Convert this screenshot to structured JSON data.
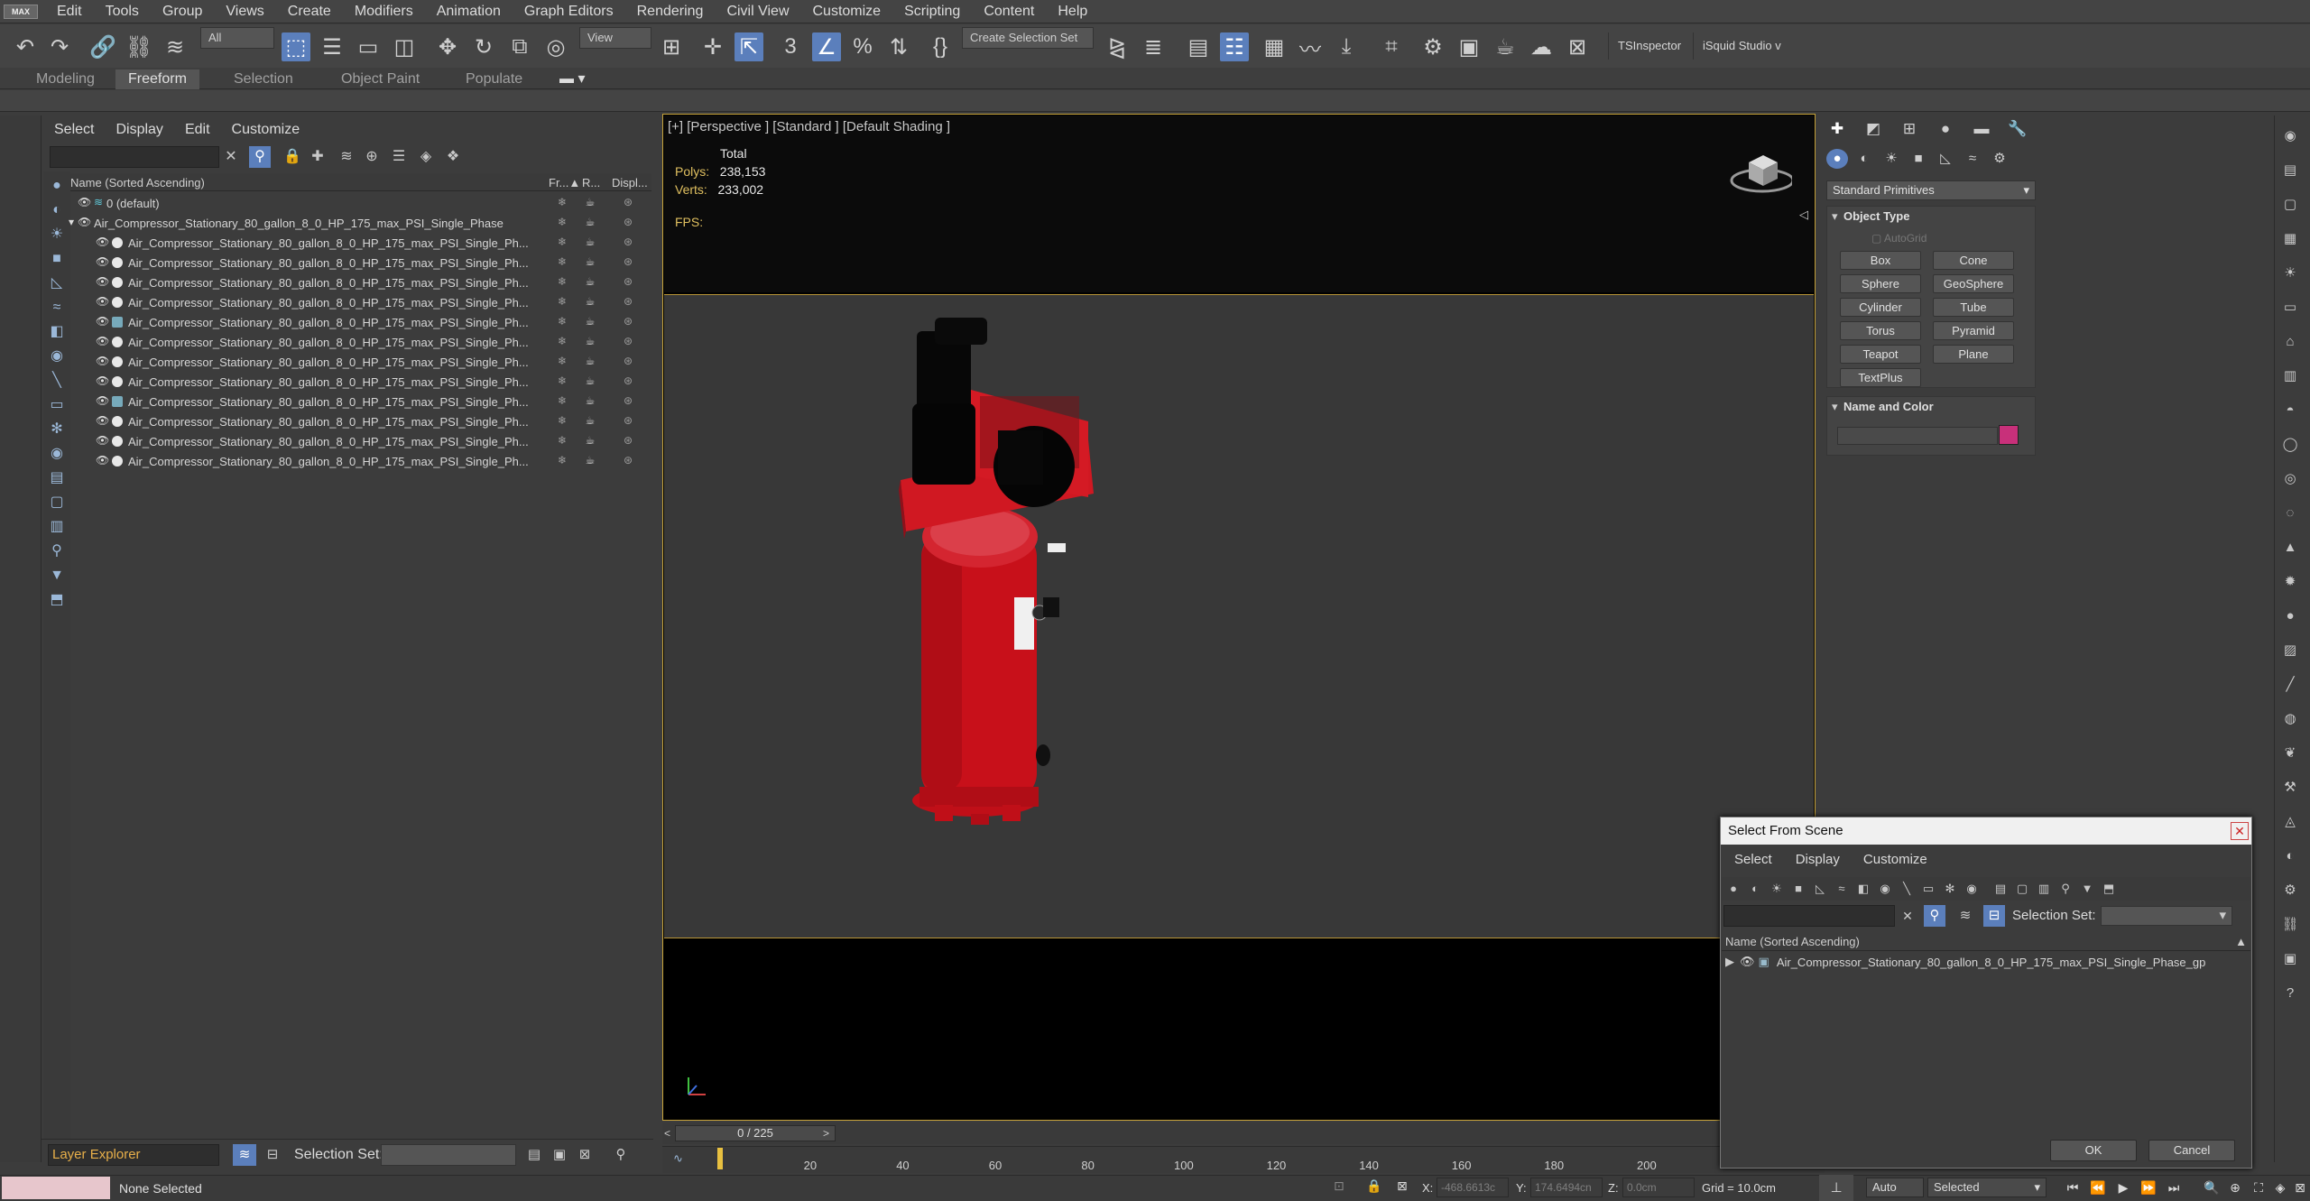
{
  "menubar": {
    "logo": "MAX",
    "items": [
      "Edit",
      "Tools",
      "Group",
      "Views",
      "Create",
      "Modifiers",
      "Animation",
      "Graph Editors",
      "Rendering",
      "Civil View",
      "Customize",
      "Scripting",
      "Content",
      "Help"
    ]
  },
  "toolbar": {
    "filter_value": "All",
    "view_value": "View",
    "selection_set_placeholder": "Create Selection Set",
    "ts_inspector": "TSInspector",
    "squid": "iSquid Studio v"
  },
  "ribbon": {
    "tabs": [
      "Modeling",
      "Freeform",
      "Selection",
      "Object Paint",
      "Populate"
    ],
    "active": "Freeform"
  },
  "scene_explorer": {
    "menu": [
      "Select",
      "Display",
      "Edit",
      "Customize"
    ],
    "columns": {
      "name": "Name (Sorted Ascending)",
      "frozen": "Fr...▲",
      "render": "R...",
      "display": "Displ..."
    },
    "rows": [
      {
        "label": "0 (default)",
        "kind": "layer",
        "indent": 0
      },
      {
        "label": "Air_Compressor_Stationary_80_gallon_8_0_HP_175_max_PSI_Single_Phase",
        "kind": "layer",
        "indent": 0
      },
      {
        "label": "Air_Compressor_Stationary_80_gallon_8_0_HP_175_max_PSI_Single_Ph...",
        "kind": "object",
        "indent": 1
      },
      {
        "label": "Air_Compressor_Stationary_80_gallon_8_0_HP_175_max_PSI_Single_Ph...",
        "kind": "object",
        "indent": 1
      },
      {
        "label": "Air_Compressor_Stationary_80_gallon_8_0_HP_175_max_PSI_Single_Ph...",
        "kind": "object",
        "indent": 1
      },
      {
        "label": "Air_Compressor_Stationary_80_gallon_8_0_HP_175_max_PSI_Single_Ph...",
        "kind": "object",
        "indent": 1
      },
      {
        "label": "Air_Compressor_Stationary_80_gallon_8_0_HP_175_max_PSI_Single_Ph...",
        "kind": "group",
        "indent": 1
      },
      {
        "label": "Air_Compressor_Stationary_80_gallon_8_0_HP_175_max_PSI_Single_Ph...",
        "kind": "object",
        "indent": 1
      },
      {
        "label": "Air_Compressor_Stationary_80_gallon_8_0_HP_175_max_PSI_Single_Ph...",
        "kind": "object",
        "indent": 1
      },
      {
        "label": "Air_Compressor_Stationary_80_gallon_8_0_HP_175_max_PSI_Single_Ph...",
        "kind": "object",
        "indent": 1
      },
      {
        "label": "Air_Compressor_Stationary_80_gallon_8_0_HP_175_max_PSI_Single_Ph...",
        "kind": "group",
        "indent": 1
      },
      {
        "label": "Air_Compressor_Stationary_80_gallon_8_0_HP_175_max_PSI_Single_Ph...",
        "kind": "object",
        "indent": 1
      },
      {
        "label": "Air_Compressor_Stationary_80_gallon_8_0_HP_175_max_PSI_Single_Ph...",
        "kind": "object",
        "indent": 1
      },
      {
        "label": "Air_Compressor_Stationary_80_gallon_8_0_HP_175_max_PSI_Single_Ph...",
        "kind": "object",
        "indent": 1
      }
    ]
  },
  "layer_bar": {
    "explorer": "Layer Explorer",
    "selection_set_label": "Selection Set:"
  },
  "viewport": {
    "label": "[+] [Perspective ] [Standard ] [Default Shading ]",
    "stats_total": "Total",
    "polys_label": "Polys:",
    "polys_value": "238,153",
    "verts_label": "Verts:",
    "verts_value": "233,002",
    "fps_label": "FPS:"
  },
  "timeline": {
    "position": "0 / 225",
    "ticks": [
      "20",
      "40",
      "60",
      "80",
      "100",
      "120",
      "140",
      "160",
      "180",
      "200"
    ]
  },
  "command_panel": {
    "category": "Standard Primitives",
    "object_type_title": "Object Type",
    "autogrid": "AutoGrid",
    "primitives": [
      "Box",
      "Cone",
      "Sphere",
      "GeoSphere",
      "Cylinder",
      "Tube",
      "Torus",
      "Pyramid",
      "Teapot",
      "Plane",
      "TextPlus"
    ],
    "name_color_title": "Name and Color",
    "swatch_color": "#c8307a"
  },
  "select_dialog": {
    "title": "Select From Scene",
    "close": "✕",
    "menu": [
      "Select",
      "Display",
      "Customize"
    ],
    "selection_set_label": "Selection Set:",
    "column": "Name (Sorted Ascending)",
    "row": "Air_Compressor_Stationary_80_gallon_8_0_HP_175_max_PSI_Single_Phase_gp",
    "ok": "OK",
    "cancel": "Cancel"
  },
  "status": {
    "text": "None Selected",
    "x_label": "X:",
    "x_value": "-468.6613c",
    "y_label": "Y:",
    "y_value": "174.6494cn",
    "z_label": "Z:",
    "z_value": "0.0cm",
    "grid": "Grid = 10.0cm",
    "auto": "Auto",
    "selected": "Selected"
  },
  "colors": {
    "accent": "#5b7fbc",
    "viewport_frame": "#c8a43a",
    "compressor": "#d0141e"
  }
}
